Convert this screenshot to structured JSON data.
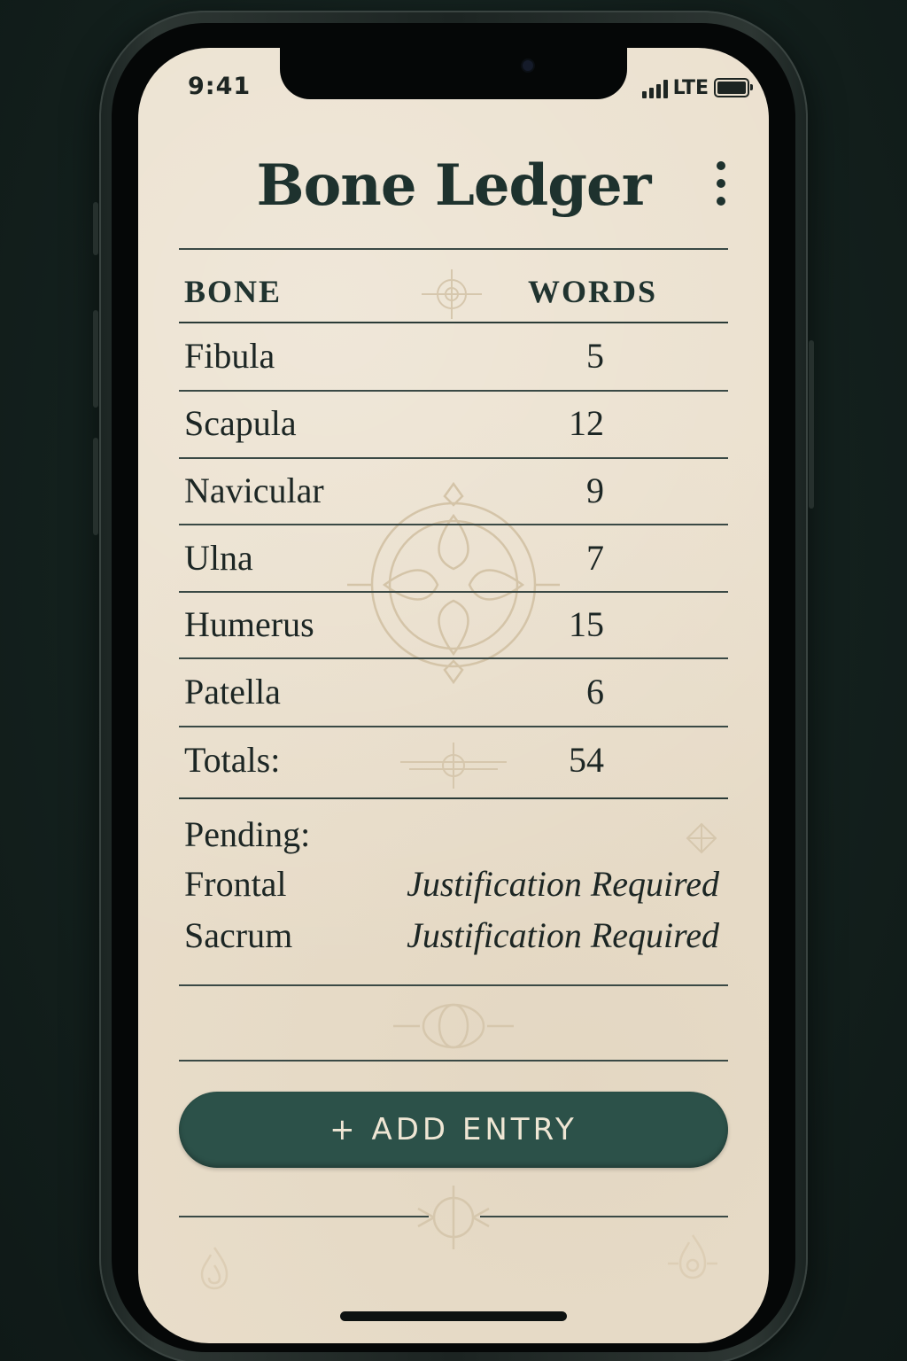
{
  "status_bar": {
    "time": "9:41",
    "network": "LTE"
  },
  "header": {
    "title": "Bone Ledger"
  },
  "table": {
    "columns": [
      "BONE",
      "WORDS"
    ],
    "rows": [
      {
        "bone": "Fibula",
        "words": "5"
      },
      {
        "bone": "Scapula",
        "words": "12"
      },
      {
        "bone": "Navicular",
        "words": "9"
      },
      {
        "bone": "Ulna",
        "words": "7"
      },
      {
        "bone": "Humerus",
        "words": "15"
      },
      {
        "bone": "Patella",
        "words": "6"
      }
    ],
    "totals_label": "Totals:",
    "totals_value": "54"
  },
  "pending": {
    "label": "Pending:",
    "items": [
      {
        "bone": "Frontal",
        "status": "Justification Required"
      },
      {
        "bone": "Sacrum",
        "status": "Justification Required"
      }
    ]
  },
  "actions": {
    "add_entry_label": "+ ADD ENTRY"
  },
  "icons": {
    "menu": "more-vertical-icon",
    "signal": "signal-bars-icon",
    "battery": "battery-icon"
  },
  "colors": {
    "paper": "#eadfcc",
    "ink": "#1e322e",
    "button": "#2c5149",
    "button_text": "#efe6d4"
  }
}
